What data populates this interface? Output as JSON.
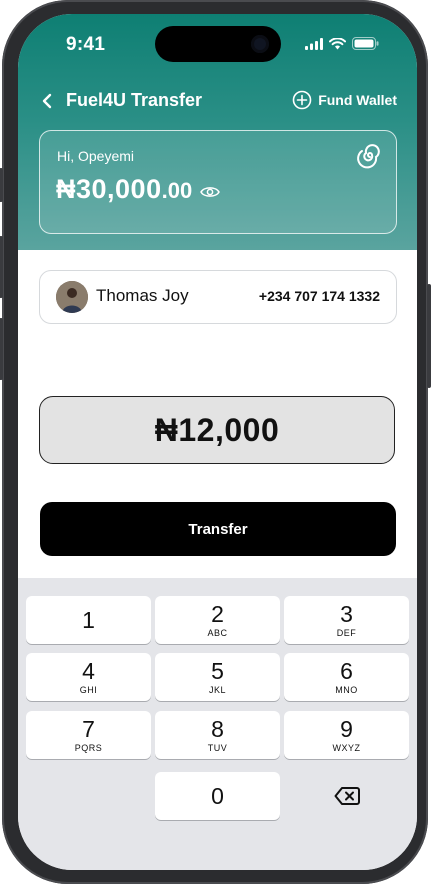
{
  "status_bar": {
    "time": "9:41"
  },
  "nav": {
    "title": "Fuel4U Transfer",
    "fund_label": "Fund Wallet"
  },
  "wallet": {
    "greeting": "Hi, Opeyemi",
    "balance_main": "₦30,000",
    "balance_decimal": ".00"
  },
  "contact": {
    "name": "Thomas Joy",
    "phone": "+234 707 174 1332"
  },
  "amount": "₦12,000",
  "transfer_label": "Transfer",
  "keypad": {
    "k1": {
      "num": "1",
      "letters": ""
    },
    "k2": {
      "num": "2",
      "letters": "ABC"
    },
    "k3": {
      "num": "3",
      "letters": "DEF"
    },
    "k4": {
      "num": "4",
      "letters": "GHI"
    },
    "k5": {
      "num": "5",
      "letters": "JKL"
    },
    "k6": {
      "num": "6",
      "letters": "MNO"
    },
    "k7": {
      "num": "7",
      "letters": "PQRS"
    },
    "k8": {
      "num": "8",
      "letters": "TUV"
    },
    "k9": {
      "num": "9",
      "letters": "WXYZ"
    },
    "k0": {
      "num": "0",
      "letters": ""
    }
  },
  "colors": {
    "brand": "#0e7f73",
    "button": "#000000",
    "keypad_bg": "#e4e5e9"
  },
  "icons": [
    "back-chevron-icon",
    "plus-circle-icon",
    "eye-icon",
    "swirl-logo-icon",
    "backspace-icon",
    "signal-icon",
    "wifi-icon",
    "battery-icon"
  ]
}
